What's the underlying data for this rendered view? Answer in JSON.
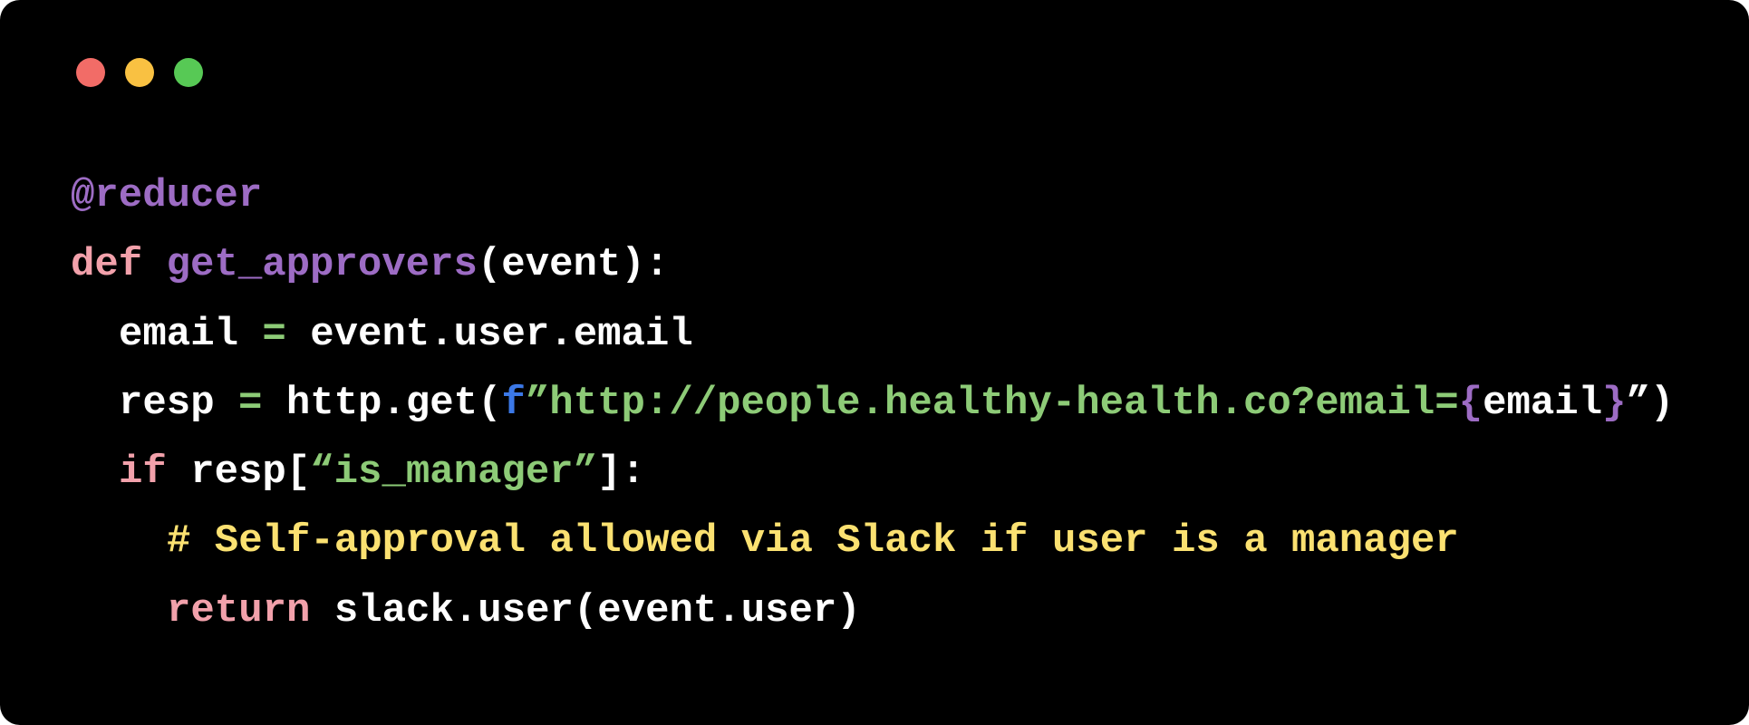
{
  "window": {
    "controls": [
      {
        "name": "close",
        "color": "#f26c67"
      },
      {
        "name": "minimize",
        "color": "#f9c142"
      },
      {
        "name": "maximize",
        "color": "#57c955"
      }
    ]
  },
  "colors": {
    "background": "#000000",
    "default": "#ffffff",
    "keyword": "#f2a1ab",
    "decorator": "#9d6cc4",
    "function": "#9d6cc4",
    "operator": "#8dcb77",
    "string": "#8dcb77",
    "fprefix": "#3b78e7",
    "brace": "#9d6cc4",
    "comment": "#fbe171"
  },
  "code": {
    "lines": [
      {
        "indent": 0,
        "tokens": [
          {
            "t": "@reducer",
            "k": "decorator"
          }
        ]
      },
      {
        "indent": 0,
        "tokens": [
          {
            "t": "def",
            "k": "keyword"
          },
          {
            "t": " ",
            "k": "default"
          },
          {
            "t": "get_approvers",
            "k": "function"
          },
          {
            "t": "(event):",
            "k": "default"
          }
        ]
      },
      {
        "indent": 1,
        "tokens": [
          {
            "t": "email",
            "k": "default"
          },
          {
            "t": " = ",
            "k": "operator"
          },
          {
            "t": "event.user.email",
            "k": "default"
          }
        ]
      },
      {
        "indent": 1,
        "tokens": [
          {
            "t": "resp",
            "k": "default"
          },
          {
            "t": " = ",
            "k": "operator"
          },
          {
            "t": "http.get(",
            "k": "default"
          },
          {
            "t": "f",
            "k": "fprefix"
          },
          {
            "t": "”http://people.healthy-health.co?email=",
            "k": "string"
          },
          {
            "t": "{",
            "k": "brace"
          },
          {
            "t": "email",
            "k": "default"
          },
          {
            "t": "}",
            "k": "brace"
          },
          {
            "t": "”)",
            "k": "default"
          }
        ]
      },
      {
        "indent": 1,
        "tokens": [
          {
            "t": "if",
            "k": "keyword"
          },
          {
            "t": " resp[",
            "k": "default"
          },
          {
            "t": "“is_manager”",
            "k": "string"
          },
          {
            "t": "]:",
            "k": "default"
          }
        ]
      },
      {
        "indent": 2,
        "tokens": [
          {
            "t": "# Self-approval allowed via Slack if user is a manager",
            "k": "comment"
          }
        ]
      },
      {
        "indent": 2,
        "tokens": [
          {
            "t": "return",
            "k": "keyword"
          },
          {
            "t": " slack.user(event.user)",
            "k": "default"
          }
        ]
      }
    ]
  }
}
